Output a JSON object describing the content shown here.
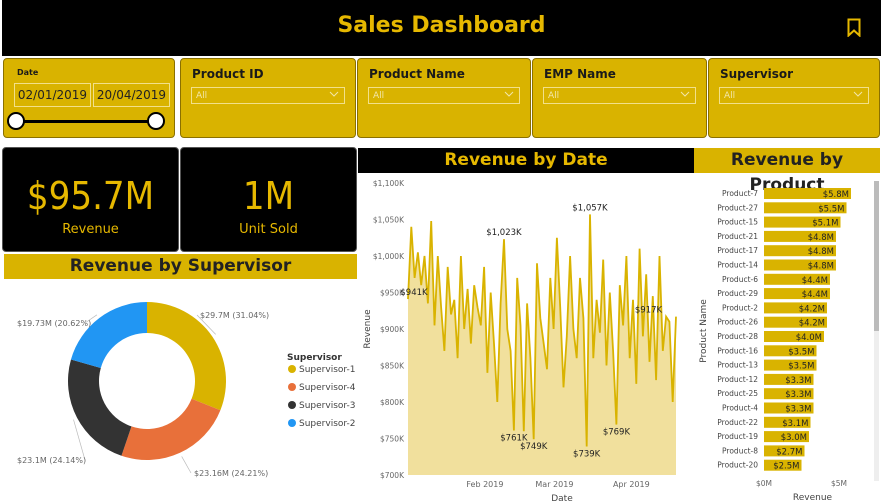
{
  "header": {
    "title": "Sales Dashboard",
    "bookmark_icon": "bookmark-icon"
  },
  "filters": {
    "date": {
      "label": "Date",
      "start": "02/01/2019",
      "end": "20/04/2019"
    },
    "dropdowns": [
      {
        "label": "Product ID",
        "value": "All"
      },
      {
        "label": "Product Name",
        "value": "All"
      },
      {
        "label": "EMP Name",
        "value": "All"
      },
      {
        "label": "Supervisor",
        "value": "All"
      }
    ]
  },
  "kpis": [
    {
      "value": "$95.7M",
      "caption": "Revenue"
    },
    {
      "value": "1M",
      "caption": "Unit Sold"
    }
  ],
  "sections": {
    "supervisor_title": "Revenue by Supervisor",
    "date_title": "Revenue by Date",
    "product_title": "Revenue by Product"
  },
  "colors": {
    "gold": "#E6B800",
    "band": "#D9B300",
    "black": "#000000",
    "s1": "#D9B300",
    "s2": "#E8703A",
    "s3": "#333333",
    "s4": "#2196F3"
  },
  "chart_data": [
    {
      "type": "pie",
      "donut": true,
      "legend_title": "Supervisor",
      "legend_position": "right",
      "slices": [
        {
          "name": "Supervisor-1",
          "value": 29.7,
          "label": "$29.7M (31.04%)",
          "color": "#D9B300"
        },
        {
          "name": "Supervisor-4",
          "value": 23.16,
          "label": "$23.16M (24.21%)",
          "color": "#E8703A"
        },
        {
          "name": "Supervisor-3",
          "value": 23.1,
          "label": "$23.1M (24.14%)",
          "color": "#333333"
        },
        {
          "name": "Supervisor-2",
          "value": 19.73,
          "label": "$19.73M (20.62%)",
          "color": "#2196F3"
        }
      ]
    },
    {
      "type": "area",
      "xlabel": "Date",
      "ylabel": "Revenue",
      "ylim": [
        700,
        1100
      ],
      "yticks": [
        "$700K",
        "$750K",
        "$800K",
        "$850K",
        "$900K",
        "$950K",
        "$1,000K",
        "$1,050K",
        "$1,100K"
      ],
      "xticks": [
        {
          "label": "Feb 2019",
          "day": 31
        },
        {
          "label": "Mar 2019",
          "day": 59
        },
        {
          "label": "Apr 2019",
          "day": 90
        }
      ],
      "x_start": "2019-01-02",
      "x_end": "2019-04-20",
      "values": [
        941,
        1040,
        970,
        1005,
        960,
        1000,
        935,
        1048,
        905,
        1000,
        930,
        870,
        985,
        920,
        940,
        860,
        1000,
        900,
        955,
        880,
        960,
        930,
        905,
        985,
        840,
        950,
        880,
        800,
        935,
        1023,
        900,
        870,
        761,
        970,
        905,
        760,
        935,
        860,
        749,
        990,
        915,
        880,
        845,
        970,
        900,
        1025,
        930,
        820,
        890,
        1000,
        900,
        860,
        970,
        915,
        739,
        1057,
        860,
        940,
        895,
        995,
        850,
        950,
        870,
        769,
        960,
        905,
        1000,
        860,
        940,
        825,
        1010,
        890,
        975,
        855,
        945,
        830,
        1000,
        870,
        917,
        910,
        800,
        917
      ],
      "annotations": [
        {
          "index": 0,
          "label": "$941K"
        },
        {
          "index": 29,
          "label": "$1,023K"
        },
        {
          "index": 32,
          "label": "$761K"
        },
        {
          "index": 38,
          "label": "$749K"
        },
        {
          "index": 54,
          "label": "$739K"
        },
        {
          "index": 55,
          "label": "$1,057K"
        },
        {
          "index": 63,
          "label": "$769K"
        },
        {
          "index": 78,
          "label": "$917K"
        }
      ]
    },
    {
      "type": "bar",
      "orientation": "horizontal",
      "xlabel": "Revenue",
      "ylabel": "Product Name",
      "xlim": [
        0,
        5.8
      ],
      "xticks": [
        "$0M",
        "$5M"
      ],
      "categories": [
        "Product-7",
        "Product-27",
        "Product-15",
        "Product-21",
        "Product-17",
        "Product-14",
        "Product-6",
        "Product-29",
        "Product-2",
        "Product-26",
        "Product-28",
        "Product-16",
        "Product-13",
        "Product-12",
        "Product-25",
        "Product-4",
        "Product-22",
        "Product-19",
        "Product-8",
        "Product-20"
      ],
      "values": [
        5.8,
        5.5,
        5.1,
        4.8,
        4.8,
        4.8,
        4.4,
        4.4,
        4.2,
        4.2,
        4.0,
        3.5,
        3.5,
        3.3,
        3.3,
        3.3,
        3.1,
        3.0,
        2.7,
        2.5
      ],
      "labels": [
        "$5.8M",
        "$5.5M",
        "$5.1M",
        "$4.8M",
        "$4.8M",
        "$4.8M",
        "$4.4M",
        "$4.4M",
        "$4.2M",
        "$4.2M",
        "$4.0M",
        "$3.5M",
        "$3.5M",
        "$3.3M",
        "$3.3M",
        "$3.3M",
        "$3.1M",
        "$3.0M",
        "$2.7M",
        "$2.5M"
      ]
    }
  ]
}
